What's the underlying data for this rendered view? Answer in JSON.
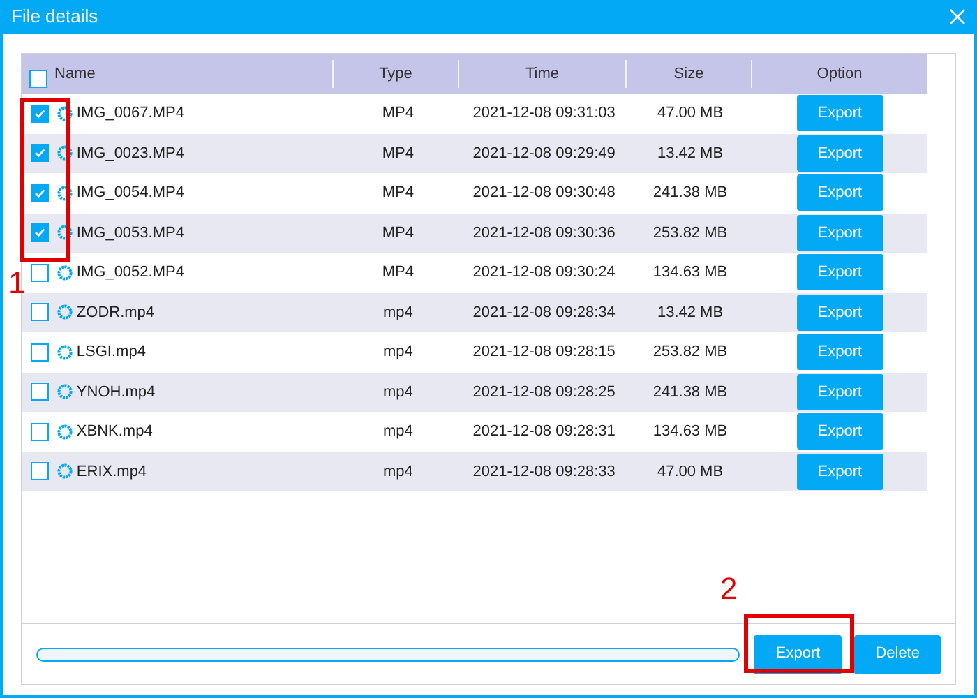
{
  "window": {
    "title": "File details"
  },
  "table": {
    "select_all": {
      "checked": false
    },
    "columns": [
      "Name",
      "Type",
      "Time",
      "Size",
      "Option"
    ],
    "rows": [
      {
        "checked": true,
        "name": "IMG_0067.MP4",
        "type": "MP4",
        "time": "2021-12-08 09:31:03",
        "size": "47.00 MB",
        "action": "Export"
      },
      {
        "checked": true,
        "name": "IMG_0023.MP4",
        "type": "MP4",
        "time": "2021-12-08 09:29:49",
        "size": "13.42 MB",
        "action": "Export"
      },
      {
        "checked": true,
        "name": "IMG_0054.MP4",
        "type": "MP4",
        "time": "2021-12-08 09:30:48",
        "size": "241.38 MB",
        "action": "Export"
      },
      {
        "checked": true,
        "name": "IMG_0053.MP4",
        "type": "MP4",
        "time": "2021-12-08 09:30:36",
        "size": "253.82 MB",
        "action": "Export"
      },
      {
        "checked": false,
        "name": "IMG_0052.MP4",
        "type": "MP4",
        "time": "2021-12-08 09:30:24",
        "size": "134.63 MB",
        "action": "Export"
      },
      {
        "checked": false,
        "name": "ZODR.mp4",
        "type": "mp4",
        "time": "2021-12-08 09:28:34",
        "size": "13.42 MB",
        "action": "Export"
      },
      {
        "checked": false,
        "name": "LSGI.mp4",
        "type": "mp4",
        "time": "2021-12-08 09:28:15",
        "size": "253.82 MB",
        "action": "Export"
      },
      {
        "checked": false,
        "name": "YNOH.mp4",
        "type": "mp4",
        "time": "2021-12-08 09:28:25",
        "size": "241.38 MB",
        "action": "Export"
      },
      {
        "checked": false,
        "name": "XBNK.mp4",
        "type": "mp4",
        "time": "2021-12-08 09:28:31",
        "size": "134.63 MB",
        "action": "Export"
      },
      {
        "checked": false,
        "name": "ERIX.mp4",
        "type": "mp4",
        "time": "2021-12-08 09:28:33",
        "size": "47.00 MB",
        "action": "Export"
      }
    ]
  },
  "progress": {
    "level": 0
  },
  "buttons": [
    "Export",
    "Delete"
  ],
  "annotations": [
    "1",
    "2"
  ]
}
